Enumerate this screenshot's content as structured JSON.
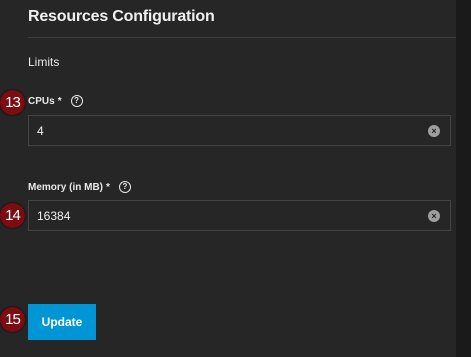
{
  "form": {
    "title": "Resources Configuration",
    "section": "Limits",
    "cpus": {
      "label": "CPUs",
      "required_mark": "*",
      "help_icon": "?",
      "value": "4"
    },
    "memory": {
      "label": "Memory (in MB)",
      "required_mark": "*",
      "help_icon": "?",
      "value": "16384"
    },
    "clear_icon": "×",
    "update_label": "Update"
  },
  "step_markers": [
    "13",
    "14",
    "15"
  ],
  "colors": {
    "background": "#262626",
    "accent": "#0095d5",
    "marker": "#7a0c12"
  }
}
